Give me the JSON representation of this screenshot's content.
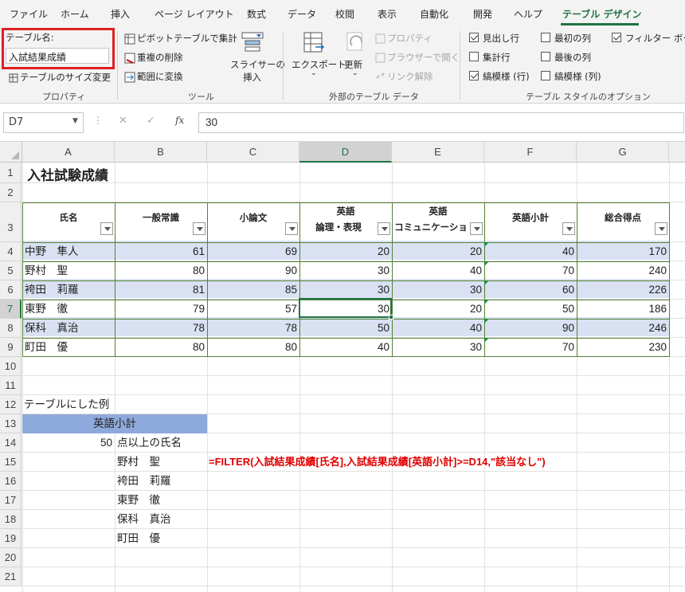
{
  "ribbon_tabs": [
    "ファイル",
    "ホーム",
    "挿入",
    "ページ レイアウト",
    "数式",
    "データ",
    "校閲",
    "表示",
    "自動化",
    "開発",
    "ヘルプ",
    "テーブル デザイン"
  ],
  "properties": {
    "table_name_label": "テーブル名:",
    "table_name_value": "入試結果成績",
    "resize": "テーブルのサイズ変更",
    "group": "プロパティ"
  },
  "tools": {
    "pivot": "ピボットテーブルで集計",
    "remove_dup": "重複の削除",
    "convert": "範囲に変換",
    "slicer_l1": "スライサーの",
    "slicer_l2": "挿入",
    "group": "ツール"
  },
  "external": {
    "export": "エクスポート",
    "refresh": "更新",
    "properties": "プロパティ",
    "browser": "ブラウザーで開く",
    "unlink": "リンク解除",
    "group": "外部のテーブル データ"
  },
  "style_options": {
    "header_row": "見出し行",
    "total_row": "集計行",
    "banded_rows": "縞模様 (行)",
    "first_col": "最初の列",
    "last_col": "最後の列",
    "banded_cols": "縞模様 (列)",
    "filter_btn": "フィルター ボタン",
    "group": "テーブル スタイルのオプション",
    "header_row_on": true,
    "total_row_on": false,
    "banded_rows_on": true,
    "first_col_on": false,
    "last_col_on": false,
    "banded_cols_on": false,
    "filter_btn_on": true
  },
  "formula_bar": {
    "name_box": "D7",
    "cancel": "✕",
    "enter": "✓",
    "fx": "fx",
    "value": "30"
  },
  "columns": [
    "A",
    "B",
    "C",
    "D",
    "E",
    "F",
    "G"
  ],
  "rows": [
    "1",
    "2",
    "3",
    "4",
    "5",
    "6",
    "7",
    "8",
    "9",
    "10",
    "11",
    "12",
    "13",
    "14",
    "15",
    "16",
    "17",
    "18",
    "19",
    "20",
    "21"
  ],
  "sheet": {
    "title": "入社試験成績",
    "headers": [
      {
        "l1": "氏名",
        "l2": ""
      },
      {
        "l1": "一般常識",
        "l2": ""
      },
      {
        "l1": "小論文",
        "l2": ""
      },
      {
        "l1": "英語",
        "l2": "論理・表現"
      },
      {
        "l1": "英語",
        "l2": "コミュニケーショ"
      },
      {
        "l1": "英語小計",
        "l2": ""
      },
      {
        "l1": "総合得点",
        "l2": ""
      }
    ],
    "data": [
      [
        "中野　隼人",
        "61",
        "69",
        "20",
        "20",
        "40",
        "170"
      ],
      [
        "野村　聖",
        "80",
        "90",
        "30",
        "40",
        "70",
        "240"
      ],
      [
        "袴田　莉羅",
        "81",
        "85",
        "30",
        "30",
        "60",
        "226"
      ],
      [
        "東野　徹",
        "79",
        "57",
        "30",
        "20",
        "50",
        "186"
      ],
      [
        "保科　真治",
        "78",
        "78",
        "50",
        "40",
        "90",
        "246"
      ],
      [
        "町田　優",
        "80",
        "80",
        "40",
        "30",
        "70",
        "230"
      ]
    ],
    "example_label": "テーブルにした例",
    "crit_header": "英語小計",
    "crit_value": "50",
    "crit_suffix": "点以上の氏名",
    "results": [
      "野村　聖",
      "袴田　莉羅",
      "東野　徹",
      "保科　真治",
      "町田　優"
    ],
    "formula_text": "=FILTER(入試結果成績[氏名],入試結果成績[英語小計]>=D14,\"該当なし\")"
  },
  "colors": {
    "accent": "#217346",
    "band": "#d9e1f2",
    "crit": "#8ea9db",
    "highlight": "#e02020",
    "formula": "#e00000"
  }
}
